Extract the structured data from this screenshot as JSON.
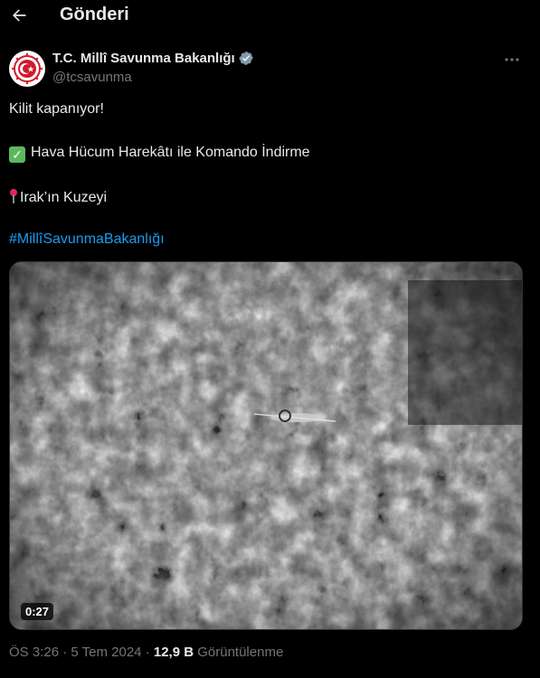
{
  "header": {
    "back_icon": "arrow-left-icon",
    "title": "Gönderi"
  },
  "post": {
    "author_name": "T.C. Millî Savunma Bakanlığı",
    "author_handle": "@tcsavunma",
    "verified_color": "#829aab",
    "text_line1": "Kilit kapanıyor!",
    "text_line2": "Hava Hücum Harekâtı ile Komando İndirme",
    "text_line3": "Irak’ın Kuzeyi",
    "hashtag": "#MillîSavunmaBakanlığı",
    "video_duration": "0:27",
    "time": "ÖS 3:26",
    "separator": "·",
    "date": "5 Tem 2024",
    "views_count": "12,9 B",
    "views_label": "Görüntülenme"
  },
  "colors": {
    "link": "#1d9bf0",
    "secondary": "#71767b",
    "text": "#e7e9ea",
    "background": "#000000"
  }
}
